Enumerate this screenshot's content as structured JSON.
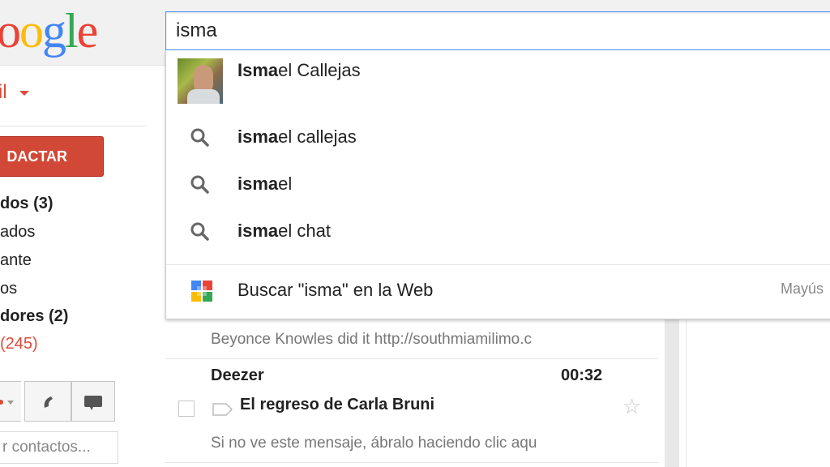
{
  "header": {
    "logo_text": "oogle",
    "search_value": "isma"
  },
  "sidebar": {
    "mail_label": "il",
    "compose_label": "DACTAR",
    "items": [
      {
        "label": "dos (3)",
        "style": "bold"
      },
      {
        "label": "ados",
        "style": "normal"
      },
      {
        "label": "ante",
        "style": "normal"
      },
      {
        "label": "os",
        "style": "normal"
      },
      {
        "label": "dores (2)",
        "style": "bold"
      },
      {
        "label": "(245)",
        "style": "red"
      }
    ],
    "contact_search_placeholder": "r contactos..."
  },
  "dropdown": {
    "person": {
      "bold": "Isma",
      "rest": "el Callejas"
    },
    "suggestions": [
      {
        "bold": "isma",
        "rest": "el callejas"
      },
      {
        "bold": "isma",
        "rest": "el"
      },
      {
        "bold": "isma",
        "rest": "el chat"
      }
    ],
    "web_search_label": "Buscar \"isma\" en la Web",
    "shortcut_hint": "Mayús"
  },
  "messages": [
    {
      "snippet": "Beyonce Knowles did it http://southmiamilimo.c"
    },
    {
      "sender": "Deezer",
      "time": "00:32",
      "subject": "El regreso de Carla Bruni",
      "snippet": "Si no ve este mensaje, ábralo haciendo clic aqu"
    }
  ],
  "colors": {
    "google_blue": "#4285f4",
    "google_red": "#ea4335",
    "google_yellow": "#fbbc05",
    "google_green": "#34a853",
    "compose_red": "#d14836",
    "focus_blue": "#4d90fe"
  },
  "icons": {
    "search": "search-icon",
    "web": "google-plus-icon",
    "phone": "phone-icon",
    "video": "video-icon",
    "star": "star-icon",
    "label": "label-icon"
  }
}
